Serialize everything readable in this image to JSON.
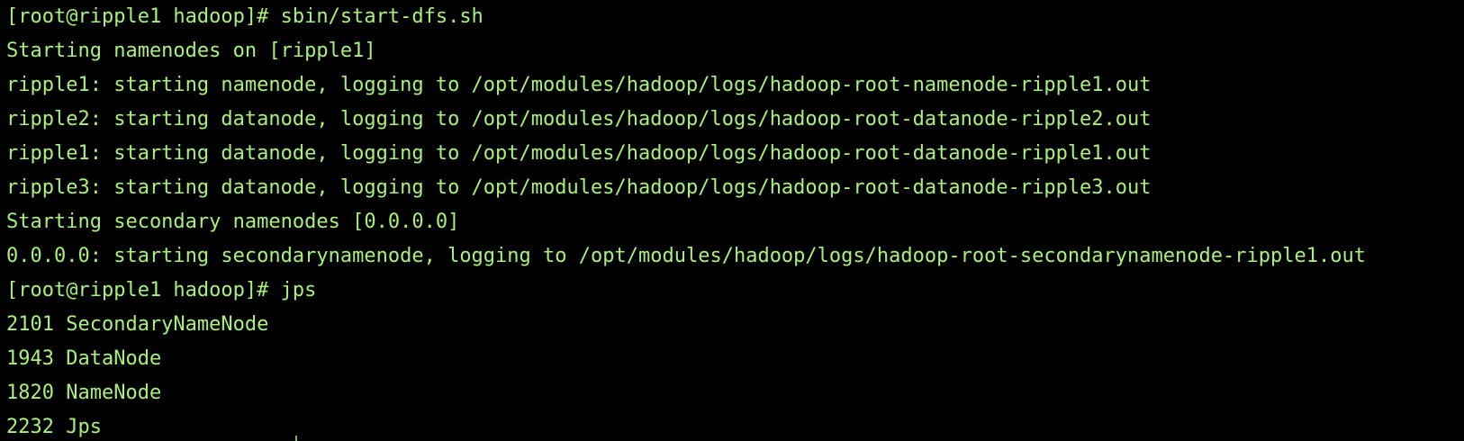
{
  "terminal": {
    "colors": {
      "background": "#000000",
      "text": "#a8f07a"
    },
    "lines": [
      {
        "kind": "prompt",
        "text": "[root@ripple1 hadoop]# sbin/start-dfs.sh"
      },
      {
        "kind": "output",
        "text": "Starting namenodes on [ripple1]"
      },
      {
        "kind": "output",
        "text": "ripple1: starting namenode, logging to /opt/modules/hadoop/logs/hadoop-root-namenode-ripple1.out"
      },
      {
        "kind": "output",
        "text": "ripple2: starting datanode, logging to /opt/modules/hadoop/logs/hadoop-root-datanode-ripple2.out"
      },
      {
        "kind": "output",
        "text": "ripple1: starting datanode, logging to /opt/modules/hadoop/logs/hadoop-root-datanode-ripple1.out"
      },
      {
        "kind": "output",
        "text": "ripple3: starting datanode, logging to /opt/modules/hadoop/logs/hadoop-root-datanode-ripple3.out"
      },
      {
        "kind": "output",
        "text": "Starting secondary namenodes [0.0.0.0]"
      },
      {
        "kind": "output",
        "text": "0.0.0.0: starting secondarynamenode, logging to /opt/modules/hadoop/logs/hadoop-root-secondarynamenode-ripple1.out"
      },
      {
        "kind": "prompt",
        "text": "[root@ripple1 hadoop]# jps"
      },
      {
        "kind": "output",
        "text": "2101 SecondaryNameNode"
      },
      {
        "kind": "output",
        "text": "1943 DataNode"
      },
      {
        "kind": "output",
        "text": "1820 NameNode"
      },
      {
        "kind": "output",
        "text": "2232 Jps"
      }
    ]
  }
}
